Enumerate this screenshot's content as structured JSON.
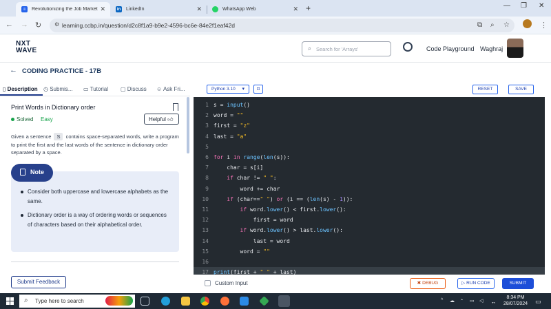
{
  "browser": {
    "tabs": [
      {
        "label": "Revolutionizing the Job Market",
        "icon": "ccbp-icon",
        "active": true
      },
      {
        "label": "LinkedIn",
        "icon": "linkedin-icon",
        "active": false
      },
      {
        "label": "WhatsApp Web",
        "icon": "whatsapp-icon",
        "active": false
      }
    ],
    "url": "learning.ccbp.in/question/d2c8f1a9-b9e2-4596-bc6e-84e2f1eaf42d"
  },
  "header": {
    "logo_line1": "NXT",
    "logo_line2": "WAVE",
    "search_placeholder": "Search for 'Arrays'",
    "playground_label": "Code Playground",
    "user_name": "Waghraj"
  },
  "practice": {
    "title": "CODING PRACTICE - 17B"
  },
  "left_tabs": [
    "Description",
    "Submis...",
    "Tutorial",
    "Discuss",
    "Ask Fri..."
  ],
  "question": {
    "title": "Print Words in Dictionary order",
    "status": "Solved",
    "difficulty": "Easy",
    "helpful_label": "Helpful",
    "desc_part1": "Given a sentence",
    "desc_code": "S",
    "desc_part2": "contains space-separated words, write a program to print the first and the last words of the sentence in dictionary order separated by a space.",
    "note_label": "Note",
    "notes": [
      "Consider both uppercase and lowercase alphabets as the same.",
      "Dictionary order is a way of ordering words or sequences of characters based on their alphabetical order."
    ]
  },
  "editor": {
    "language": "Python 3.10",
    "reset_label": "RESET",
    "save_label": "SAVE",
    "active_line": 17,
    "lines": [
      "s = input()",
      "word = \"\"",
      "first = \"z\"",
      "last = \"a\"",
      "",
      "for i in range(len(s)):",
      "    char = s[i]",
      "    if char != \" \":",
      "        word += char",
      "    if (char==\" \") or (i == (len(s) - 1)):",
      "        if word.lower() < first.lower():",
      "            first = word",
      "        if word.lower() > last.lower():",
      "            last = word",
      "        word = \"\"",
      "",
      "print(first + \" \" + last)"
    ]
  },
  "footer": {
    "feedback_label": "Submit Feedback",
    "custom_input_label": "Custom Input",
    "debug_label": "DEBUG",
    "run_label": "RUN CODE",
    "submit_label": "SUBMIT"
  },
  "taskbar": {
    "search_placeholder": "Type here to search",
    "time": "8:34 PM",
    "date": "28/07/2024"
  },
  "colors": {
    "accent": "#1d4ed8",
    "editor_bg": "#242a30",
    "note_bg": "#e8edf8"
  }
}
